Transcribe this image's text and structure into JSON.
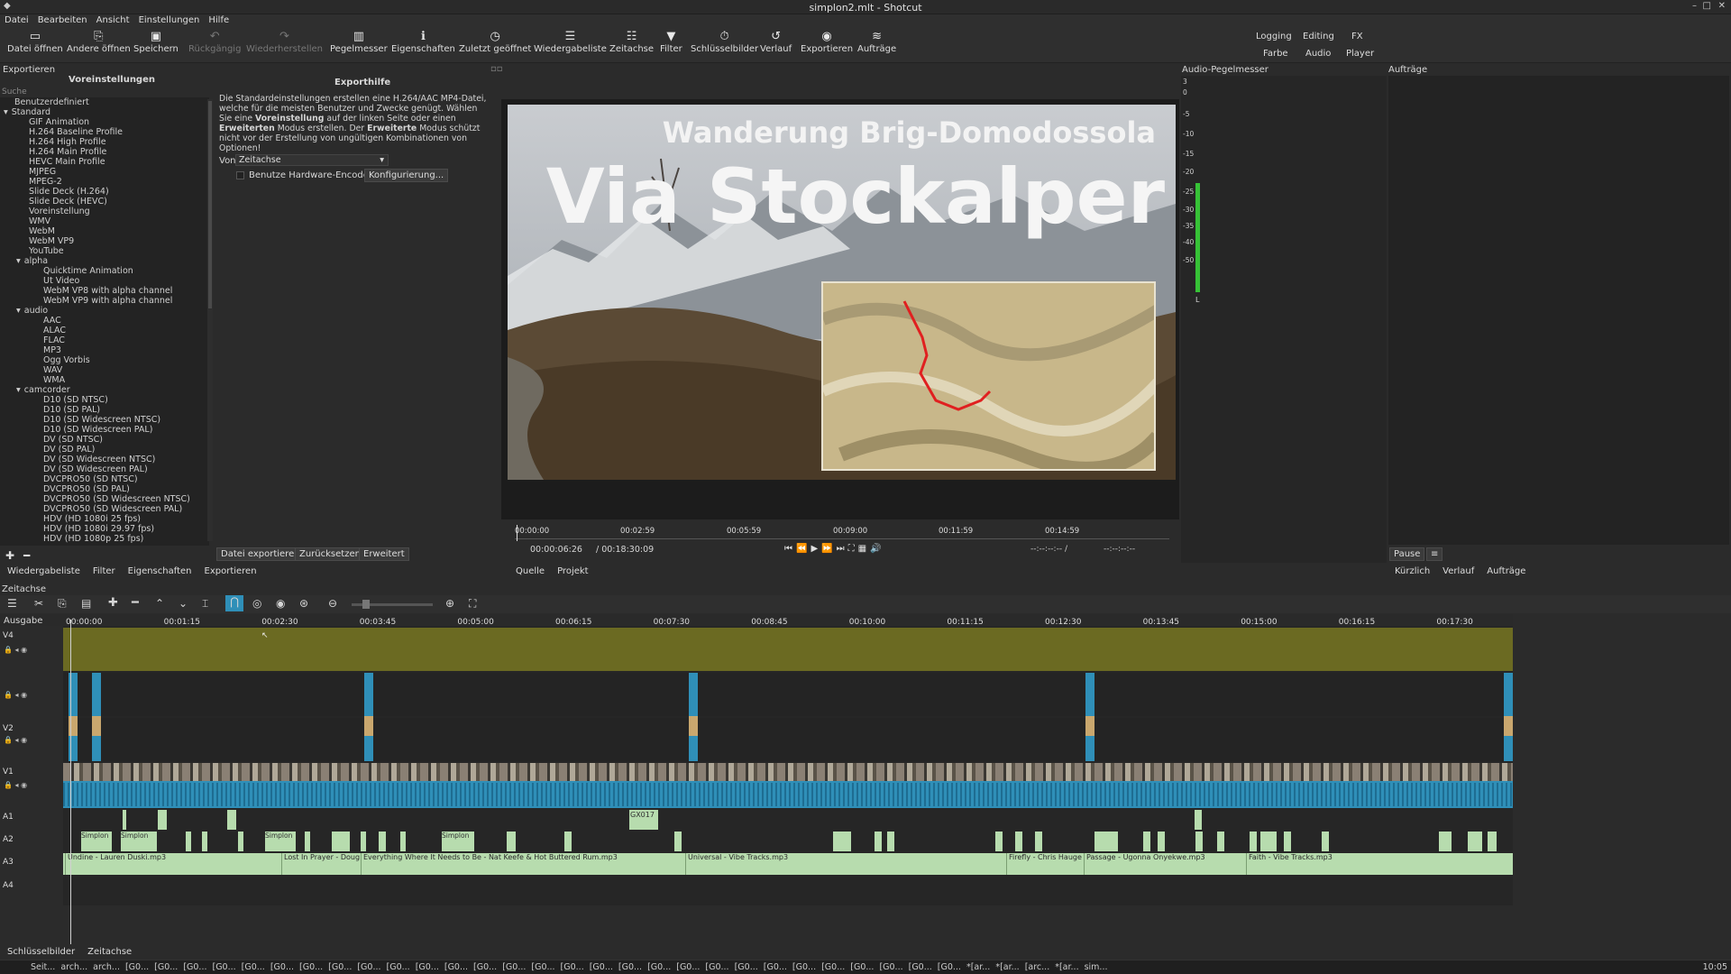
{
  "window": {
    "title": "simplon2.mlt - Shotcut"
  },
  "menu": [
    "Datei",
    "Bearbeiten",
    "Ansicht",
    "Einstellungen",
    "Hilfe"
  ],
  "toolbar": [
    {
      "label": "Datei öffnen",
      "icon": "folder-open-icon",
      "enabled": true
    },
    {
      "label": "Andere öffnen",
      "icon": "open-other-icon",
      "enabled": true
    },
    {
      "label": "Speichern",
      "icon": "save-icon",
      "enabled": true
    },
    {
      "label": "Rückgängig",
      "icon": "undo-icon",
      "enabled": false
    },
    {
      "label": "Wiederherstellen",
      "icon": "redo-icon",
      "enabled": false
    },
    {
      "label": "Pegelmesser",
      "icon": "meter-icon",
      "enabled": true
    },
    {
      "label": "Eigenschaften",
      "icon": "info-icon",
      "enabled": true
    },
    {
      "label": "Zuletzt geöffnet",
      "icon": "clock-icon",
      "enabled": true
    },
    {
      "label": "Wiedergabeliste",
      "icon": "list-icon",
      "enabled": true
    },
    {
      "label": "Zeitachse",
      "icon": "timeline-icon",
      "enabled": true
    },
    {
      "label": "Filter",
      "icon": "filter-icon",
      "enabled": true
    },
    {
      "label": "Schlüsselbilder",
      "icon": "stopwatch-icon",
      "enabled": true
    },
    {
      "label": "Verlauf",
      "icon": "history-icon",
      "enabled": true
    },
    {
      "label": "Exportieren",
      "icon": "export-icon",
      "enabled": true
    },
    {
      "label": "Aufträge",
      "icon": "jobs-icon",
      "enabled": true
    }
  ],
  "workspaces": {
    "row1": [
      "Logging",
      "Editing",
      "FX"
    ],
    "row2": [
      "Farbe",
      "Audio",
      "Player"
    ]
  },
  "export_panel": {
    "title": "Exportieren",
    "presets_title": "Voreinstellungen",
    "search_placeholder": "Suche",
    "help_title": "Exporthilfe",
    "help_text_1": "Die Standardeinstellungen erstellen eine H.264/AAC MP4-Datei, welche für die meisten Benutzer und Zwecke genügt. Wählen Sie eine",
    "help_bold_1": "Voreinstellung",
    "help_text_2": "auf der linken Seite oder einen",
    "help_bold_2": "Erweiterten",
    "help_text_3": "Modus erstellen. Der",
    "help_bold_3": "Erweiterte",
    "help_text_4": "Modus schützt nicht vor der Erstellung von ungültigen Kombinationen von Optionen!",
    "from_label": "Von",
    "from_value": "Zeitachse",
    "hw_encoder_label": "Benutze Hardware-Encoder",
    "configure_button": "Konfigurierung...",
    "export_file_button": "Datei exportieren",
    "reset_button": "Zurücksetzen",
    "advanced_button": "Erweitert"
  },
  "presets": [
    {
      "label": "Benutzerdefiniert",
      "level": 0,
      "arrow": ""
    },
    {
      "label": "Standard",
      "level": 0,
      "arrow": "▾"
    },
    {
      "label": "GIF Animation",
      "level": 1,
      "arrow": ""
    },
    {
      "label": "H.264 Baseline Profile",
      "level": 1,
      "arrow": ""
    },
    {
      "label": "H.264 High Profile",
      "level": 1,
      "arrow": ""
    },
    {
      "label": "H.264 Main Profile",
      "level": 1,
      "arrow": ""
    },
    {
      "label": "HEVC Main Profile",
      "level": 1,
      "arrow": ""
    },
    {
      "label": "MJPEG",
      "level": 1,
      "arrow": ""
    },
    {
      "label": "MPEG-2",
      "level": 1,
      "arrow": ""
    },
    {
      "label": "Slide Deck (H.264)",
      "level": 1,
      "arrow": ""
    },
    {
      "label": "Slide Deck (HEVC)",
      "level": 1,
      "arrow": ""
    },
    {
      "label": "Voreinstellung",
      "level": 1,
      "arrow": ""
    },
    {
      "label": "WMV",
      "level": 1,
      "arrow": ""
    },
    {
      "label": "WebM",
      "level": 1,
      "arrow": ""
    },
    {
      "label": "WebM VP9",
      "level": 1,
      "arrow": ""
    },
    {
      "label": "YouTube",
      "level": 1,
      "arrow": ""
    },
    {
      "label": "alpha",
      "level": 1,
      "arrow": "▾"
    },
    {
      "label": "Quicktime Animation",
      "level": 2,
      "arrow": ""
    },
    {
      "label": "Ut Video",
      "level": 2,
      "arrow": ""
    },
    {
      "label": "WebM VP8 with alpha channel",
      "level": 2,
      "arrow": ""
    },
    {
      "label": "WebM VP9 with alpha channel",
      "level": 2,
      "arrow": ""
    },
    {
      "label": "audio",
      "level": 1,
      "arrow": "▾"
    },
    {
      "label": "AAC",
      "level": 2,
      "arrow": ""
    },
    {
      "label": "ALAC",
      "level": 2,
      "arrow": ""
    },
    {
      "label": "FLAC",
      "level": 2,
      "arrow": ""
    },
    {
      "label": "MP3",
      "level": 2,
      "arrow": ""
    },
    {
      "label": "Ogg Vorbis",
      "level": 2,
      "arrow": ""
    },
    {
      "label": "WAV",
      "level": 2,
      "arrow": ""
    },
    {
      "label": "WMA",
      "level": 2,
      "arrow": ""
    },
    {
      "label": "camcorder",
      "level": 1,
      "arrow": "▾"
    },
    {
      "label": "D10 (SD NTSC)",
      "level": 2,
      "arrow": ""
    },
    {
      "label": "D10 (SD PAL)",
      "level": 2,
      "arrow": ""
    },
    {
      "label": "D10 (SD Widescreen NTSC)",
      "level": 2,
      "arrow": ""
    },
    {
      "label": "D10 (SD Widescreen PAL)",
      "level": 2,
      "arrow": ""
    },
    {
      "label": "DV (SD NTSC)",
      "level": 2,
      "arrow": ""
    },
    {
      "label": "DV (SD PAL)",
      "level": 2,
      "arrow": ""
    },
    {
      "label": "DV (SD Widescreen NTSC)",
      "level": 2,
      "arrow": ""
    },
    {
      "label": "DV (SD Widescreen PAL)",
      "level": 2,
      "arrow": ""
    },
    {
      "label": "DVCPRO50 (SD NTSC)",
      "level": 2,
      "arrow": ""
    },
    {
      "label": "DVCPRO50 (SD PAL)",
      "level": 2,
      "arrow": ""
    },
    {
      "label": "DVCPRO50 (SD Widescreen NTSC)",
      "level": 2,
      "arrow": ""
    },
    {
      "label": "DVCPRO50 (SD Widescreen PAL)",
      "level": 2,
      "arrow": ""
    },
    {
      "label": "HDV (HD 1080i 25 fps)",
      "level": 2,
      "arrow": ""
    },
    {
      "label": "HDV (HD 1080i 29.97 fps)",
      "level": 2,
      "arrow": ""
    },
    {
      "label": "HDV (HD 1080p 25 fps)",
      "level": 2,
      "arrow": ""
    }
  ],
  "left_tabs": [
    "Wiedergabeliste",
    "Filter",
    "Eigenschaften",
    "Exportieren"
  ],
  "viewer": {
    "title_line1": "Wanderung Brig-Domodossola",
    "title_line2": "Via Stockalper",
    "ruler_ticks": [
      "00:00:00",
      "00:02:59",
      "00:05:59",
      "00:09:00",
      "00:11:59",
      "00:14:59"
    ],
    "current_time": "00:00:06:26",
    "total_time": "/ 00:18:30:09",
    "in_point": "--:--:--:-- /",
    "out_point": "--:--:--:--",
    "tabs": [
      "Quelle",
      "Projekt"
    ]
  },
  "audio_meter": {
    "title": "Audio-Pegelmesser",
    "scale": [
      "3",
      "0",
      "-5",
      "-10",
      "-15",
      "-20",
      "-25",
      "-30",
      "-35",
      "-40",
      "-50"
    ],
    "channel_label": "L",
    "level_db": -20
  },
  "jobs_panel": {
    "title": "Aufträge",
    "pause_button": "Pause",
    "menu_icon": "≡",
    "tabs": [
      "Kürzlich",
      "Verlauf",
      "Aufträge"
    ]
  },
  "timeline": {
    "title": "Zeitachse",
    "output_label": "Ausgabe",
    "ruler": [
      "00:00:00",
      "00:01:15",
      "00:02:30",
      "00:03:45",
      "00:05:00",
      "00:06:15",
      "00:07:30",
      "00:08:45",
      "00:10:00",
      "00:11:15",
      "00:12:30",
      "00:13:45",
      "00:15:00",
      "00:16:15",
      "00:17:30"
    ],
    "tracks": [
      "V4",
      "",
      "V2",
      "V1",
      "A1",
      "A2",
      "A3",
      "A4"
    ],
    "v3_clip_label": "GX017",
    "a2_small_labels": [
      "Simplon",
      "Simplon",
      "Simplon",
      "Simplon"
    ],
    "a3_clips": [
      "Undine - Lauren Duski.mp3",
      "Lost In Prayer - Doug",
      "Everything Where It Needs to Be - Nat Keefe & Hot Buttered Rum.mp3",
      "Universal - Vibe Tracks.mp3",
      "Firefly - Chris Hauge",
      "Passage - Ugonna Onyekwe.mp3",
      "Faith - Vibe Tracks.mp3"
    ]
  },
  "bottom_tabs": [
    "Schlüsselbilder",
    "Zeitachse"
  ],
  "taskbar": {
    "items": [
      "Seit...",
      "arch...",
      "arch...",
      "[G0...",
      "[G0...",
      "[G0...",
      "[G0...",
      "[G0...",
      "[G0...",
      "[G0...",
      "[G0...",
      "[G0...",
      "[G0...",
      "[G0...",
      "[G0...",
      "[G0...",
      "[G0...",
      "[G0...",
      "[G0...",
      "[G0...",
      "[G0...",
      "[G0...",
      "[G0...",
      "[G0...",
      "[G0...",
      "[G0...",
      "[G0...",
      "[G0...",
      "[G0...",
      "[G0...",
      "[G0...",
      "[G0...",
      "*[ar...",
      "*[ar...",
      "[arc...",
      "*[ar...",
      "sim..."
    ],
    "clock": "10:05"
  },
  "colors": {
    "accent": "#2f8fb8",
    "track_v4": "#6b6a22",
    "audio_clip": "#b7dcae",
    "meter": "#36c236"
  }
}
